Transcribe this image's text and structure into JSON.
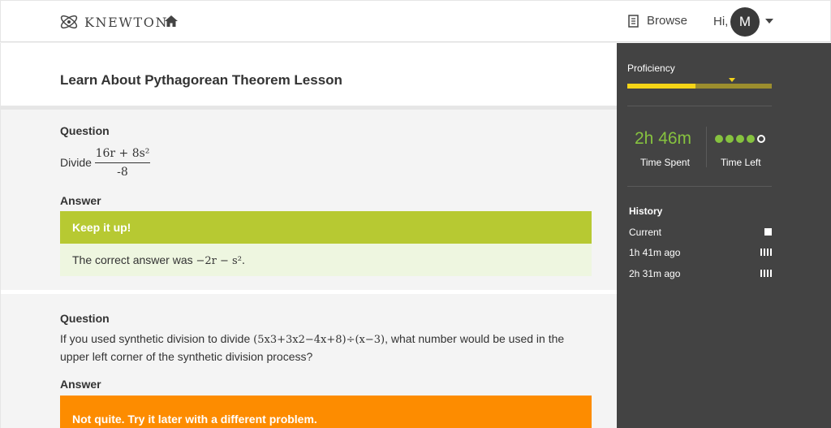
{
  "header": {
    "logo_text": "KNEWTON",
    "home_icon": "home-icon",
    "browse_label": "Browse",
    "greeting": "Hi,",
    "avatar_initial": "M"
  },
  "lesson": {
    "title": "Learn About Pythagorean Theorem Lesson"
  },
  "questions": [
    {
      "question_label": "Question",
      "prompt_prefix": "Divide",
      "fraction_numerator": "16r + 8s²",
      "fraction_denominator": "-8",
      "answer_label": "Answer",
      "feedback_title": "Keep it up!",
      "feedback_prefix": "The correct answer was ",
      "feedback_math": "−2r − s².",
      "feedback_color": "#b7c932"
    },
    {
      "question_label": "Question",
      "prompt_before": "If you used synthetic division to divide ",
      "prompt_math": "(5x3+3x2−4x+8)÷(x−3)",
      "prompt_after": ", what number would be used in the upper left corner of the synthetic division process?",
      "answer_label": "Answer",
      "feedback_title": "Not quite. Try it later with a different problem.",
      "feedback_color": "#fd8c00"
    }
  ],
  "sidebar": {
    "proficiency_label": "Proficiency",
    "proficiency_fraction": 0.47,
    "time_spent_value": "2h 46m",
    "time_spent_label": "Time Spent",
    "time_left_label": "Time Left",
    "time_left_dots_filled": 4,
    "time_left_dots_total": 5,
    "history_label": "History",
    "history": [
      {
        "label": "Current",
        "icon": "square-icon"
      },
      {
        "label": "1h 41m ago",
        "icon": "bars-icon"
      },
      {
        "label": "2h 31m ago",
        "icon": "bars-icon"
      }
    ]
  },
  "colors": {
    "accent_green": "#86c23f",
    "proficiency_yellow": "#f5d517",
    "sidebar_bg": "#434343"
  }
}
